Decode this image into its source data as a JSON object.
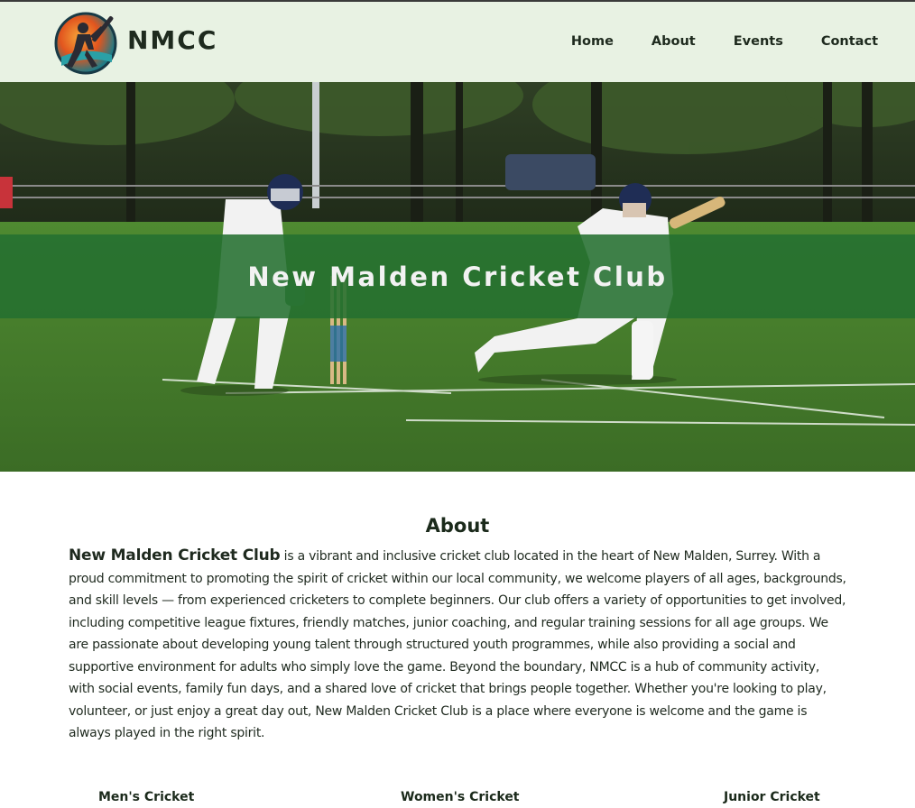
{
  "brand": {
    "name": "NMCC",
    "logo_icon": "cricket-batsman-logo-icon"
  },
  "nav": {
    "items": [
      {
        "label": "Home"
      },
      {
        "label": "About"
      },
      {
        "label": "Events"
      },
      {
        "label": "Contact"
      }
    ]
  },
  "hero": {
    "title": "New Malden Cricket Club",
    "image": "cricket-match-photo"
  },
  "about": {
    "heading": "About",
    "lead": "New Malden Cricket Club",
    "body": " is a vibrant and inclusive cricket club located in the heart of New Malden, Surrey. With a proud commitment to promoting the spirit of cricket within our local community, we welcome players of all ages, backgrounds, and skill levels — from experienced cricketers to complete beginners. Our club offers a variety of opportunities to get involved, including competitive league fixtures, friendly matches, junior coaching, and regular training sessions for all age groups. We are passionate about developing young talent through structured youth programmes, while also providing a social and supportive environment for adults who simply love the game. Beyond the boundary, NMCC is a hub of community activity, with social events, family fun days, and a shared love of cricket that brings people together. Whether you're looking to play, volunteer, or just enjoy a great day out, New Malden Cricket Club is a place where everyone is welcome and the game is always played in the right spirit."
  },
  "sections": [
    {
      "label": "Men's Cricket"
    },
    {
      "label": "Women's Cricket"
    },
    {
      "label": "Junior Cricket"
    }
  ],
  "colors": {
    "header_bg": "#e8f2e3",
    "banner_bg": "#247030",
    "text_dark": "#1e2a1e"
  }
}
